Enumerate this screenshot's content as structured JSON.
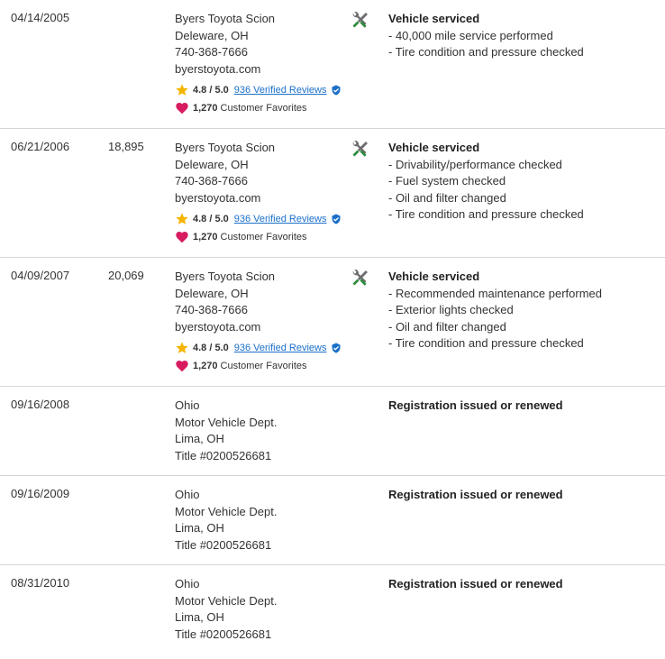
{
  "records": [
    {
      "date": "04/14/2005",
      "mileage": "",
      "source": [
        "Byers Toyota Scion",
        "Deleware, OH",
        "740-368-7666",
        "byerstoyota.com"
      ],
      "rating": "4.8 / 5.0",
      "reviews_link": "936 Verified Reviews",
      "favorites_count": "1,270",
      "favorites_label": "Customer Favorites",
      "icon": "wrench-screwdriver-icon",
      "comment_title": "Vehicle serviced",
      "comment_items": [
        "- 40,000 mile service performed",
        "- Tire condition and pressure checked"
      ]
    },
    {
      "date": "06/21/2006",
      "mileage": "18,895",
      "source": [
        "Byers Toyota Scion",
        "Deleware, OH",
        "740-368-7666",
        "byerstoyota.com"
      ],
      "rating": "4.8 / 5.0",
      "reviews_link": "936 Verified Reviews",
      "favorites_count": "1,270",
      "favorites_label": "Customer Favorites",
      "icon": "wrench-screwdriver-icon",
      "comment_title": "Vehicle serviced",
      "comment_items": [
        "- Drivability/performance checked",
        "- Fuel system checked",
        "- Oil and filter changed",
        "- Tire condition and pressure checked"
      ]
    },
    {
      "date": "04/09/2007",
      "mileage": "20,069",
      "source": [
        "Byers Toyota Scion",
        "Deleware, OH",
        "740-368-7666",
        "byerstoyota.com"
      ],
      "rating": "4.8 / 5.0",
      "reviews_link": "936 Verified Reviews",
      "favorites_count": "1,270",
      "favorites_label": "Customer Favorites",
      "icon": "wrench-screwdriver-icon",
      "comment_title": "Vehicle serviced",
      "comment_items": [
        "- Recommended maintenance performed",
        "- Exterior lights checked",
        "- Oil and filter changed",
        "- Tire condition and pressure checked"
      ]
    },
    {
      "date": "09/16/2008",
      "mileage": "",
      "source": [
        "Ohio",
        "Motor Vehicle Dept.",
        "Lima, OH",
        "Title #0200526681"
      ],
      "comment_title": "Registration issued or renewed",
      "comment_items": []
    },
    {
      "date": "09/16/2009",
      "mileage": "",
      "source": [
        "Ohio",
        "Motor Vehicle Dept.",
        "Lima, OH",
        "Title #0200526681"
      ],
      "comment_title": "Registration issued or renewed",
      "comment_items": []
    },
    {
      "date": "08/31/2010",
      "mileage": "",
      "source": [
        "Ohio",
        "Motor Vehicle Dept.",
        "Lima, OH",
        "Title #0200526681"
      ],
      "comment_title": "Registration issued or renewed",
      "comment_items": []
    }
  ],
  "colors": {
    "star": "#f5b400",
    "heart": "#d81b60",
    "link": "#1a6fc9",
    "badge": "#1a6fc9",
    "tool_green": "#2e8b3a",
    "tool_grey": "#6d6d6d"
  }
}
